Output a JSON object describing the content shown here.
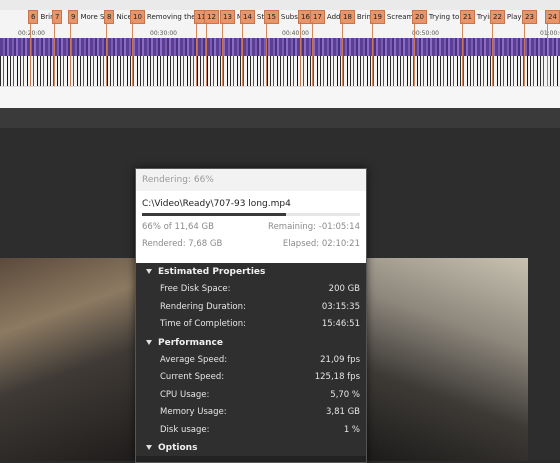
{
  "markers": [
    {
      "num": "6",
      "label": "Brin"
    },
    {
      "num": "7",
      "label": ""
    },
    {
      "num": "9",
      "label": "More S"
    },
    {
      "num": "8",
      "label": "Nice"
    },
    {
      "num": "10",
      "label": "Removing the n"
    },
    {
      "num": "11",
      "label": ""
    },
    {
      "num": "12",
      "label": ""
    },
    {
      "num": "13",
      "label": "Mi"
    },
    {
      "num": "14",
      "label": "Sta"
    },
    {
      "num": "15",
      "label": "Subse"
    },
    {
      "num": "16",
      "label": ""
    },
    {
      "num": "17",
      "label": "Addin"
    },
    {
      "num": "18",
      "label": "Brin"
    },
    {
      "num": "19",
      "label": "Screamin"
    },
    {
      "num": "20",
      "label": "Trying to a"
    },
    {
      "num": "21",
      "label": "Trying"
    },
    {
      "num": "22",
      "label": "Playi"
    },
    {
      "num": "23",
      "label": ""
    },
    {
      "num": "24",
      "label": ""
    }
  ],
  "ruler_ticks": [
    "00:20:00",
    "00:30:00",
    "00:40:00",
    "00:50:00",
    "01:00:00"
  ],
  "dialog": {
    "title": "Rendering: 66%",
    "file": "C:\\Video\\Ready\\707-93 long.mp4",
    "progress_fraction": 0.66,
    "percent_of_size": "66% of 11,64 GB",
    "remaining": "Remaining: -01:05:14",
    "rendered": "Rendered: 7,68 GB",
    "elapsed": "Elapsed: 02:10:21"
  },
  "estimated": {
    "heading": "Estimated Properties",
    "rows": [
      {
        "label": "Free Disk Space:",
        "value": "200 GB"
      },
      {
        "label": "Rendering Duration:",
        "value": "03:15:35"
      },
      {
        "label": "Time of Completion:",
        "value": "15:46:51"
      }
    ]
  },
  "performance": {
    "heading": "Performance",
    "rows": [
      {
        "label": "Average Speed:",
        "value": "21,09 fps"
      },
      {
        "label": "Current Speed:",
        "value": "125,18 fps"
      },
      {
        "label": "CPU Usage:",
        "value": "5,70 %"
      },
      {
        "label": "Memory Usage:",
        "value": "3,81 GB"
      },
      {
        "label": "Disk usage:",
        "value": "1 %"
      }
    ]
  },
  "options": {
    "heading": "Options"
  },
  "colors": {
    "marker": "#e9956a",
    "video_track": "#6a4fa6",
    "dialog_bg": "#2f2f2f"
  }
}
